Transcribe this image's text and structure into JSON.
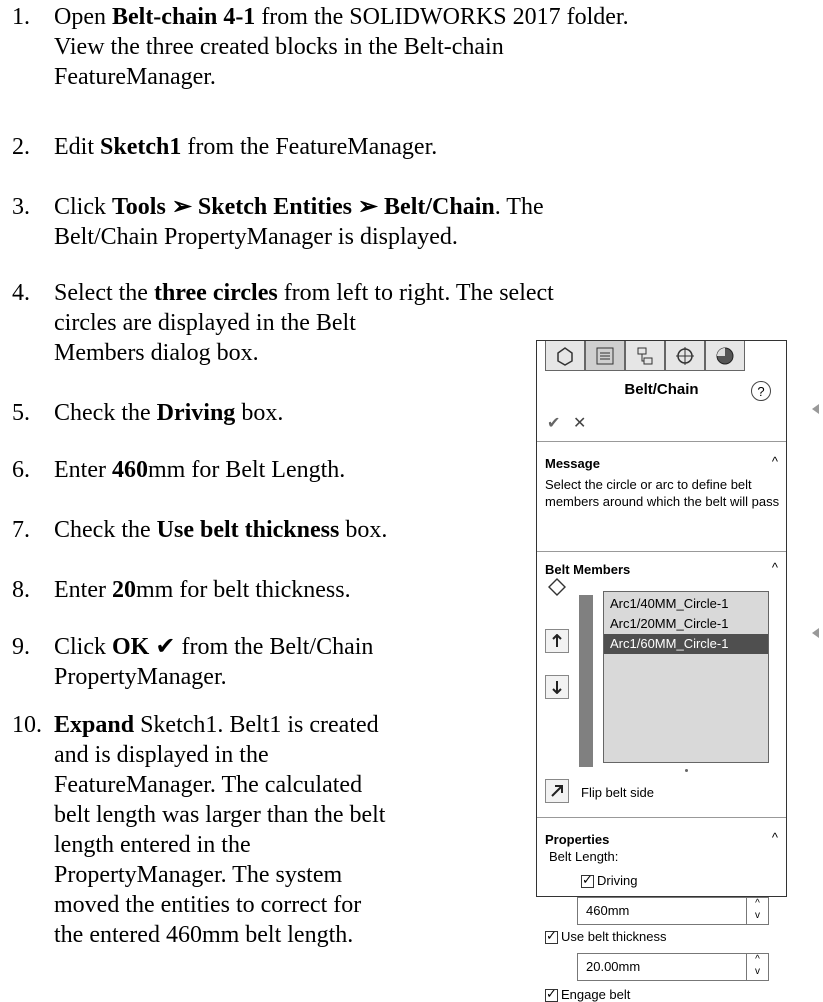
{
  "steps": [
    {
      "num": "1.",
      "lines": [
        [
          "Open ",
          "Belt-chain 4-1",
          " from the SOLIDWORKS 2017 folder."
        ],
        [
          "View the three created blocks in the Belt-chain"
        ],
        [
          "FeatureManager."
        ]
      ]
    },
    {
      "num": "2.",
      "lines": [
        [
          "Edit ",
          "Sketch1",
          " from the FeatureManager."
        ]
      ]
    },
    {
      "num": "3.",
      "lines": [
        [
          "Click ",
          "Tools ➢ Sketch Entities ➢ Belt/Chain",
          ". The"
        ],
        [
          "Belt/Chain PropertyManager is displayed."
        ]
      ]
    },
    {
      "num": "4.",
      "lines": [
        [
          "Select the ",
          "three circles",
          " from left to right. The select"
        ],
        [
          "circles are displayed in the Belt"
        ],
        [
          "Members dialog box."
        ]
      ]
    },
    {
      "num": "5.",
      "lines": [
        [
          "Check the ",
          "Driving",
          " box."
        ]
      ]
    },
    {
      "num": "6.",
      "lines": [
        [
          "Enter ",
          "460",
          "mm for Belt Length."
        ]
      ]
    },
    {
      "num": "7.",
      "lines": [
        [
          "Check the ",
          "Use belt thickness",
          " box."
        ]
      ]
    },
    {
      "num": "8.",
      "lines": [
        [
          "Enter ",
          "20",
          "mm for belt thickness."
        ]
      ]
    },
    {
      "num": "9.",
      "lines": [
        [
          "Click ",
          "OK",
          " ✔ from the Belt/Chain"
        ],
        [
          "PropertyManager."
        ]
      ]
    },
    {
      "num": "10.",
      "lines": [
        [
          "",
          "Expand",
          " Sketch1. Belt1 is created"
        ],
        [
          "and is displayed in the"
        ],
        [
          "FeatureManager. The calculated"
        ],
        [
          "belt length was larger than the belt"
        ],
        [
          "length entered in the"
        ],
        [
          "PropertyManager. The system"
        ],
        [
          "moved the entities to correct for"
        ],
        [
          "the entered 460mm belt length."
        ]
      ]
    }
  ],
  "panel": {
    "title": "Belt/Chain",
    "help": "?",
    "ok": "✔",
    "cancel": "✕",
    "message_title": "Message",
    "message_text": "Select the circle or arc to define belt members around which the belt will pass",
    "members_title": "Belt Members",
    "members": [
      "Arc1/40MM_Circle-1",
      "Arc1/20MM_Circle-1",
      "Arc1/60MM_Circle-1"
    ],
    "flip_label": "Flip belt side",
    "properties_title": "Properties",
    "belt_length_label": "Belt Length:",
    "driving_label": "Driving",
    "belt_length_value": "460mm",
    "use_thickness_label": "Use belt thickness",
    "thickness_value": "20.00mm",
    "engage_label": "Engage belt"
  }
}
